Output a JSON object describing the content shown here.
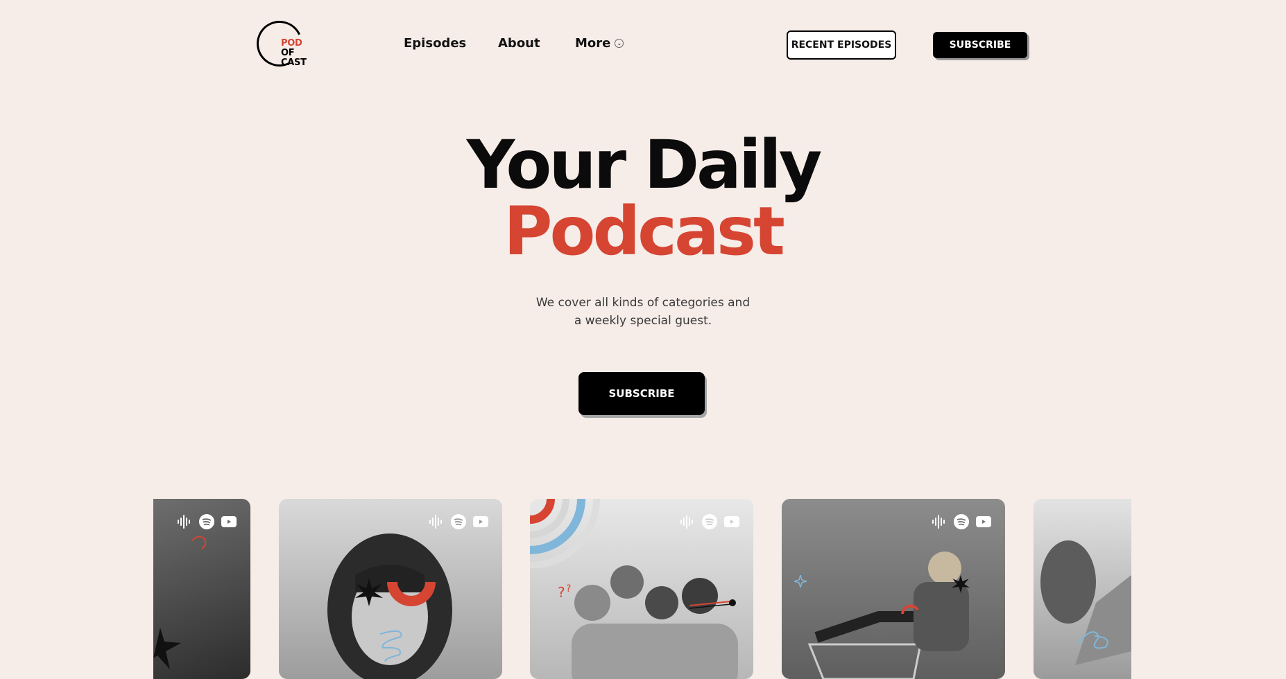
{
  "header": {
    "logo": {
      "line1": "POD",
      "line2": "OF",
      "line3": "CAST"
    },
    "nav": [
      {
        "label": "Episodes"
      },
      {
        "label": "About"
      },
      {
        "label": "More"
      }
    ],
    "recent_label": "RECENT EPISODES",
    "subscribe_label": "SUBSCRIBE"
  },
  "hero": {
    "title_line1": "Your Daily",
    "title_line2": "Podcast",
    "subtitle_line1": "We cover all kinds of categories and",
    "subtitle_line2": "a weekly special guest.",
    "cta_label": "SUBSCRIBE"
  },
  "cards": [
    {
      "icons": [
        "podcasts-icon",
        "spotify-icon",
        "youtube-icon"
      ]
    },
    {
      "icons": [
        "podcasts-icon",
        "spotify-icon",
        "youtube-icon"
      ]
    },
    {
      "icons": [
        "podcasts-icon",
        "spotify-icon",
        "youtube-icon"
      ]
    },
    {
      "icons": [
        "podcasts-icon",
        "spotify-icon",
        "youtube-icon"
      ]
    }
  ],
  "colors": {
    "background": "#f6ece8",
    "accent": "#d54532",
    "text": "#111111",
    "blue_accent": "#7fb6d9"
  }
}
